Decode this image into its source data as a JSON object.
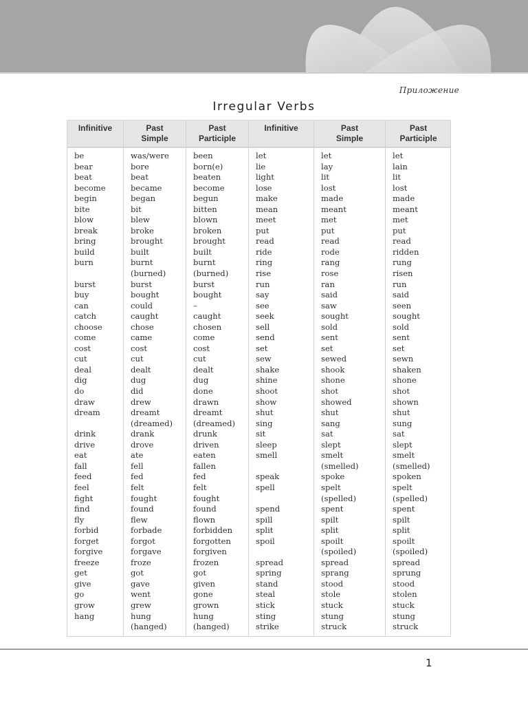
{
  "header": {
    "section_label": "Приложение",
    "title": "Irregular Verbs"
  },
  "table": {
    "headers": [
      [
        "Infinitive"
      ],
      [
        "Past",
        "Simple"
      ],
      [
        "Past",
        "Participle"
      ],
      [
        "Infinitive"
      ],
      [
        "Past",
        "Simple"
      ],
      [
        "Past",
        "Participle"
      ]
    ],
    "left": {
      "infinitive": [
        "be",
        "bear",
        "beat",
        "become",
        "begin",
        "bite",
        "blow",
        "break",
        "bring",
        "build",
        "burn",
        "",
        "burst",
        "buy",
        "can",
        "catch",
        "choose",
        "come",
        "cost",
        "cut",
        "deal",
        "dig",
        "do",
        "draw",
        "dream",
        "",
        "drink",
        "drive",
        "eat",
        "fall",
        "feed",
        "feel",
        "fight",
        "find",
        "fly",
        "forbid",
        "forget",
        "forgive",
        "freeze",
        "get",
        "give",
        "go",
        "grow",
        "hang",
        ""
      ],
      "past_simple": [
        "was/were",
        "bore",
        "beat",
        "became",
        "began",
        "bit",
        "blew",
        "broke",
        "brought",
        "built",
        "burnt",
        "(burned)",
        "burst",
        "bought",
        "could",
        "caught",
        "chose",
        "came",
        "cost",
        "cut",
        "dealt",
        "dug",
        "did",
        "drew",
        "dreamt",
        "(dreamed)",
        "drank",
        "drove",
        "ate",
        "fell",
        "fed",
        "felt",
        "fought",
        "found",
        "flew",
        "forbade",
        "forgot",
        "forgave",
        "froze",
        "got",
        "gave",
        "went",
        "grew",
        "hung",
        "(hanged)"
      ],
      "past_participle": [
        "been",
        "born(e)",
        "beaten",
        "become",
        "begun",
        "bitten",
        "blown",
        "broken",
        "brought",
        "built",
        "burnt",
        "(burned)",
        "burst",
        "bought",
        "–",
        "caught",
        "chosen",
        "come",
        "cost",
        "cut",
        "dealt",
        "dug",
        "done",
        "drawn",
        "dreamt",
        "(dreamed)",
        "drunk",
        "driven",
        "eaten",
        "fallen",
        "fed",
        "felt",
        "fought",
        "found",
        "flown",
        "forbidden",
        "forgotten",
        "forgiven",
        "frozen",
        "got",
        "given",
        "gone",
        "grown",
        "hung",
        "(hanged)"
      ]
    },
    "right": {
      "infinitive": [
        "let",
        "lie",
        "light",
        "lose",
        "make",
        "mean",
        "meet",
        "put",
        "read",
        "ride",
        "ring",
        "rise",
        "run",
        "say",
        "see",
        "seek",
        "sell",
        "send",
        "set",
        "sew",
        "shake",
        "shine",
        "shoot",
        "show",
        "shut",
        "sing",
        "sit",
        "sleep",
        "smell",
        "",
        "speak",
        "spell",
        "",
        "spend",
        "spill",
        "split",
        "spoil",
        "",
        "spread",
        "spring",
        "stand",
        "steal",
        "stick",
        "sting",
        "strike"
      ],
      "past_simple": [
        "let",
        "lay",
        "lit",
        "lost",
        "made",
        "meant",
        "met",
        "put",
        "read",
        "rode",
        "rang",
        "rose",
        "ran",
        "said",
        "saw",
        "sought",
        "sold",
        "sent",
        "set",
        "sewed",
        "shook",
        "shone",
        "shot",
        "showed",
        "shut",
        "sang",
        "sat",
        "slept",
        "smelt",
        "(smelled)",
        "spoke",
        "spelt",
        "(spelled)",
        "spent",
        "spilt",
        "split",
        "spoilt",
        "(spoiled)",
        "spread",
        "sprang",
        "stood",
        "stole",
        "stuck",
        "stung",
        "struck"
      ],
      "past_participle": [
        "let",
        "lain",
        "lit",
        "lost",
        "made",
        "meant",
        "met",
        "put",
        "read",
        "ridden",
        "rung",
        "risen",
        "run",
        "said",
        "seen",
        "sought",
        "sold",
        "sent",
        "set",
        "sewn",
        "shaken",
        "shone",
        "shot",
        "shown",
        "shut",
        "sung",
        "sat",
        "slept",
        "smelt",
        "(smelled)",
        "spoken",
        "spelt",
        "(spelled)",
        "spent",
        "spilt",
        "split",
        "spoilt",
        "(spoiled)",
        "spread",
        "sprung",
        "stood",
        "stolen",
        "stuck",
        "stung",
        "struck"
      ]
    }
  },
  "footer": {
    "page_number": "1"
  }
}
